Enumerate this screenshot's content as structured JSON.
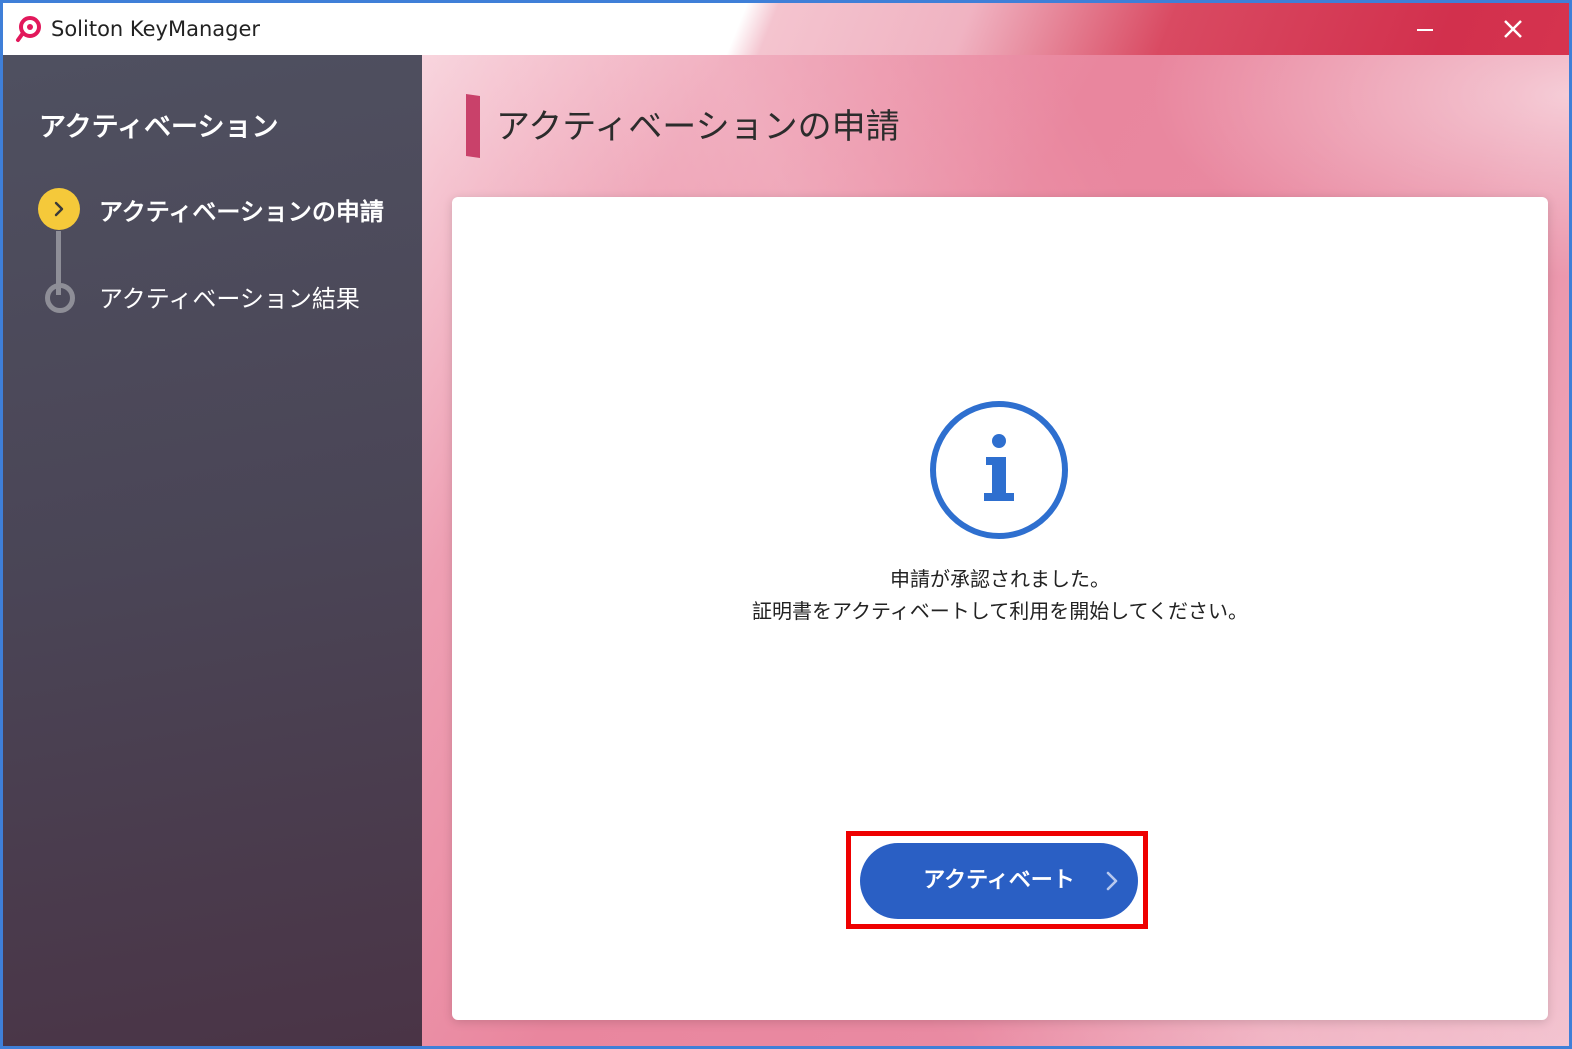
{
  "window": {
    "title": "Soliton KeyManager"
  },
  "sidebar": {
    "title": "アクティベーション",
    "steps": [
      {
        "label": "アクティベーションの申請",
        "state": "current"
      },
      {
        "label": "アクティベーション結果",
        "state": "pending"
      }
    ]
  },
  "main": {
    "page_title": "アクティベーションの申請",
    "message_line1": "申請が承認されました。",
    "message_line2": "証明書をアクティベートして利用を開始してください。",
    "activate_label": "アクティベート"
  },
  "icons": {
    "logo": "soliton-logo-icon",
    "minimize": "minimize-icon",
    "close": "close-icon",
    "info": "info-icon",
    "chevron": "chevron-right-icon"
  },
  "colors": {
    "accent_blue": "#2a5fc4",
    "step_active": "#f5c93a",
    "highlight": "#ee0000",
    "title_accent": "#c9416a"
  }
}
